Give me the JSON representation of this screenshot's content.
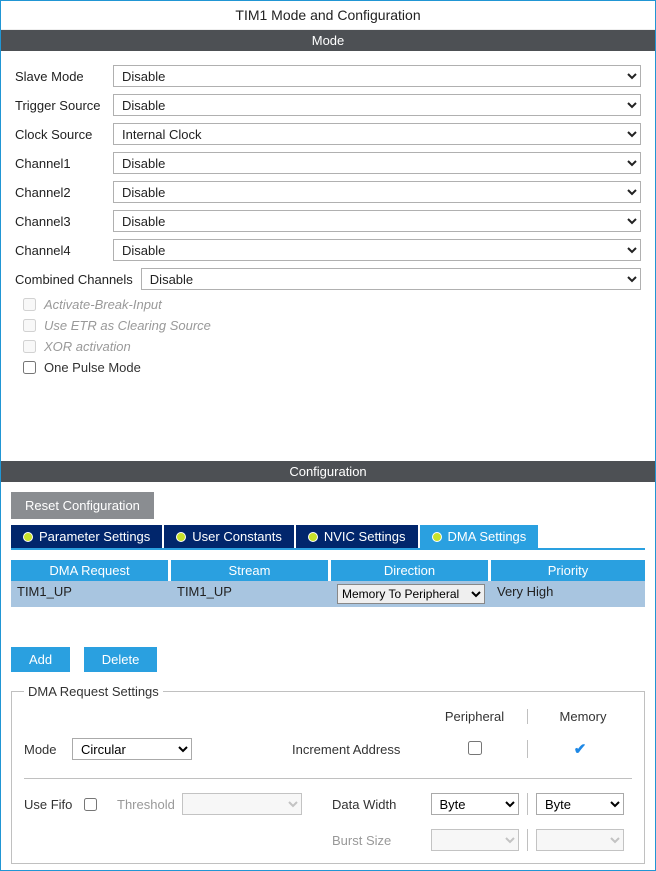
{
  "title": "TIM1 Mode and Configuration",
  "sections": {
    "mode": "Mode",
    "config": "Configuration"
  },
  "mode": {
    "rows": {
      "slave": {
        "label": "Slave Mode",
        "value": "Disable"
      },
      "trigger": {
        "label": "Trigger Source",
        "value": "Disable"
      },
      "clock": {
        "label": "Clock Source",
        "value": "Internal Clock"
      },
      "ch1": {
        "label": "Channel1",
        "value": "Disable"
      },
      "ch2": {
        "label": "Channel2",
        "value": "Disable"
      },
      "ch3": {
        "label": "Channel3",
        "value": "Disable"
      },
      "ch4": {
        "label": "Channel4",
        "value": "Disable"
      },
      "combined": {
        "label": "Combined Channels",
        "value": "Disable"
      }
    },
    "checks": {
      "break": {
        "label": "Activate-Break-Input",
        "checked": false,
        "disabled": true
      },
      "etr": {
        "label": "Use ETR as Clearing Source",
        "checked": false,
        "disabled": true
      },
      "xor": {
        "label": "XOR activation",
        "checked": false,
        "disabled": true
      },
      "onepulse": {
        "label": "One Pulse Mode",
        "checked": false,
        "disabled": false
      }
    }
  },
  "config": {
    "reset": "Reset Configuration",
    "tabs": {
      "param": "Parameter Settings",
      "user": "User Constants",
      "nvic": "NVIC Settings",
      "dma": "DMA Settings"
    },
    "active_tab": "dma",
    "dma_table": {
      "headers": {
        "req": "DMA Request",
        "stream": "Stream",
        "dir": "Direction",
        "pri": "Priority"
      },
      "row": {
        "req": "TIM1_UP",
        "stream": "TIM1_UP",
        "dir": "Memory To Peripheral",
        "pri": "Very High"
      }
    },
    "buttons": {
      "add": "Add",
      "delete": "Delete"
    },
    "settings": {
      "legend": "DMA Request Settings",
      "headers": {
        "periph": "Peripheral",
        "mem": "Memory"
      },
      "mode": {
        "label": "Mode",
        "value": "Circular"
      },
      "incr": {
        "label": "Increment Address",
        "periph_checked": false,
        "mem_checked": true
      },
      "fifo": {
        "label": "Use Fifo",
        "checked": false
      },
      "threshold": {
        "label": "Threshold",
        "value": ""
      },
      "datawidth": {
        "label": "Data Width",
        "periph": "Byte",
        "mem": "Byte"
      },
      "burst": {
        "label": "Burst Size",
        "periph": "",
        "mem": ""
      }
    }
  }
}
